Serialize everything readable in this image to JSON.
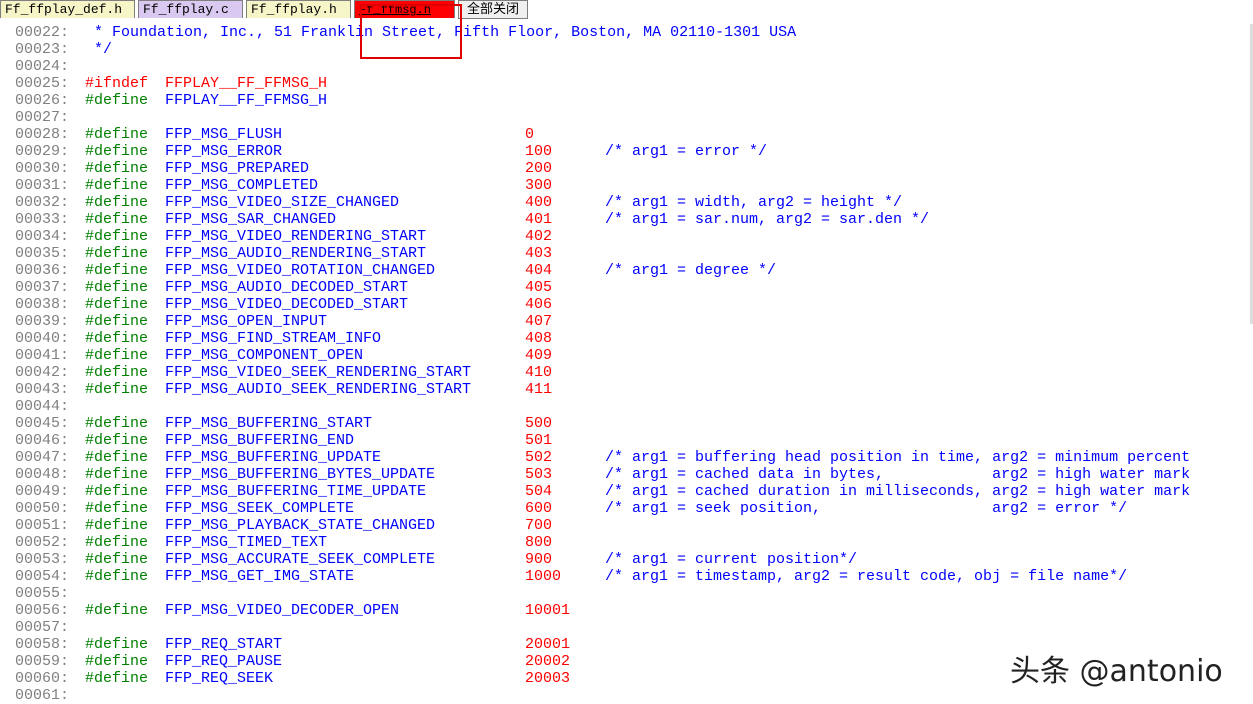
{
  "tabs": [
    {
      "label": "Ff_ffplay_def.h",
      "bg": "#f5f5c8"
    },
    {
      "label": "Ff_ffplay.c",
      "bg": "#d9c8ef"
    },
    {
      "label": "Ff_ffplay.h",
      "bg": "#f5f5c8"
    },
    {
      "label": "Ff_ffmsg.h",
      "bg": "#ff0000"
    }
  ],
  "close_all_label": "全部关闭",
  "header_lines": [
    {
      "num": "00022:",
      "text": " * Foundation, Inc., 51 Franklin Street, Fifth Floor, Boston, MA 02110-1301 USA"
    },
    {
      "num": "00023:",
      "text": " */"
    },
    {
      "num": "00024:",
      "text": ""
    }
  ],
  "guard_lines": [
    {
      "num": "00025:",
      "kw": "#ifndef",
      "ident": "FFPLAY__FF_FFMSG_H"
    },
    {
      "num": "00026:",
      "kw": "#define",
      "ident": "FFPLAY__FF_FFMSG_H"
    }
  ],
  "define_lines": [
    {
      "num": "00027:",
      "kw": "",
      "ident": "",
      "val": "",
      "cmt": ""
    },
    {
      "num": "00028:",
      "kw": "#define",
      "ident": "FFP_MSG_FLUSH",
      "val": "0",
      "cmt": ""
    },
    {
      "num": "00029:",
      "kw": "#define",
      "ident": "FFP_MSG_ERROR",
      "val": "100",
      "cmt": "/* arg1 = error */"
    },
    {
      "num": "00030:",
      "kw": "#define",
      "ident": "FFP_MSG_PREPARED",
      "val": "200",
      "cmt": ""
    },
    {
      "num": "00031:",
      "kw": "#define",
      "ident": "FFP_MSG_COMPLETED",
      "val": "300",
      "cmt": ""
    },
    {
      "num": "00032:",
      "kw": "#define",
      "ident": "FFP_MSG_VIDEO_SIZE_CHANGED",
      "val": "400",
      "cmt": "/* arg1 = width, arg2 = height */"
    },
    {
      "num": "00033:",
      "kw": "#define",
      "ident": "FFP_MSG_SAR_CHANGED",
      "val": "401",
      "cmt": "/* arg1 = sar.num, arg2 = sar.den */"
    },
    {
      "num": "00034:",
      "kw": "#define",
      "ident": "FFP_MSG_VIDEO_RENDERING_START",
      "val": "402",
      "cmt": ""
    },
    {
      "num": "00035:",
      "kw": "#define",
      "ident": "FFP_MSG_AUDIO_RENDERING_START",
      "val": "403",
      "cmt": ""
    },
    {
      "num": "00036:",
      "kw": "#define",
      "ident": "FFP_MSG_VIDEO_ROTATION_CHANGED",
      "val": "404",
      "cmt": "/* arg1 = degree */"
    },
    {
      "num": "00037:",
      "kw": "#define",
      "ident": "FFP_MSG_AUDIO_DECODED_START",
      "val": "405",
      "cmt": ""
    },
    {
      "num": "00038:",
      "kw": "#define",
      "ident": "FFP_MSG_VIDEO_DECODED_START",
      "val": "406",
      "cmt": ""
    },
    {
      "num": "00039:",
      "kw": "#define",
      "ident": "FFP_MSG_OPEN_INPUT",
      "val": "407",
      "cmt": ""
    },
    {
      "num": "00040:",
      "kw": "#define",
      "ident": "FFP_MSG_FIND_STREAM_INFO",
      "val": "408",
      "cmt": ""
    },
    {
      "num": "00041:",
      "kw": "#define",
      "ident": "FFP_MSG_COMPONENT_OPEN",
      "val": "409",
      "cmt": ""
    },
    {
      "num": "00042:",
      "kw": "#define",
      "ident": "FFP_MSG_VIDEO_SEEK_RENDERING_START",
      "val": "410",
      "cmt": ""
    },
    {
      "num": "00043:",
      "kw": "#define",
      "ident": "FFP_MSG_AUDIO_SEEK_RENDERING_START",
      "val": "411",
      "cmt": ""
    },
    {
      "num": "00044:",
      "kw": "",
      "ident": "",
      "val": "",
      "cmt": ""
    },
    {
      "num": "00045:",
      "kw": "#define",
      "ident": "FFP_MSG_BUFFERING_START",
      "val": "500",
      "cmt": ""
    },
    {
      "num": "00046:",
      "kw": "#define",
      "ident": "FFP_MSG_BUFFERING_END",
      "val": "501",
      "cmt": ""
    },
    {
      "num": "00047:",
      "kw": "#define",
      "ident": "FFP_MSG_BUFFERING_UPDATE",
      "val": "502",
      "cmt": "/* arg1 = buffering head position in time, arg2 = minimum percent"
    },
    {
      "num": "00048:",
      "kw": "#define",
      "ident": "FFP_MSG_BUFFERING_BYTES_UPDATE",
      "val": "503",
      "cmt": "/* arg1 = cached data in bytes,            arg2 = high water mark"
    },
    {
      "num": "00049:",
      "kw": "#define",
      "ident": "FFP_MSG_BUFFERING_TIME_UPDATE",
      "val": "504",
      "cmt": "/* arg1 = cached duration in milliseconds, arg2 = high water mark"
    },
    {
      "num": "00050:",
      "kw": "#define",
      "ident": "FFP_MSG_SEEK_COMPLETE",
      "val": "600",
      "cmt": "/* arg1 = seek position,                   arg2 = error */"
    },
    {
      "num": "00051:",
      "kw": "#define",
      "ident": "FFP_MSG_PLAYBACK_STATE_CHANGED",
      "val": "700",
      "cmt": ""
    },
    {
      "num": "00052:",
      "kw": "#define",
      "ident": "FFP_MSG_TIMED_TEXT",
      "val": "800",
      "cmt": ""
    },
    {
      "num": "00053:",
      "kw": "#define",
      "ident": "FFP_MSG_ACCURATE_SEEK_COMPLETE",
      "val": "900",
      "cmt": "/* arg1 = current position*/"
    },
    {
      "num": "00054:",
      "kw": "#define",
      "ident": "FFP_MSG_GET_IMG_STATE",
      "val": "1000",
      "cmt": "/* arg1 = timestamp, arg2 = result code, obj = file name*/"
    },
    {
      "num": "00055:",
      "kw": "",
      "ident": "",
      "val": "",
      "cmt": ""
    },
    {
      "num": "00056:",
      "kw": "#define",
      "ident": "FFP_MSG_VIDEO_DECODER_OPEN",
      "val": "10001",
      "cmt": ""
    },
    {
      "num": "00057:",
      "kw": "",
      "ident": "",
      "val": "",
      "cmt": ""
    },
    {
      "num": "00058:",
      "kw": "#define",
      "ident": "FFP_REQ_START",
      "val": "20001",
      "cmt": ""
    },
    {
      "num": "00059:",
      "kw": "#define",
      "ident": "FFP_REQ_PAUSE",
      "val": "20002",
      "cmt": ""
    },
    {
      "num": "00060:",
      "kw": "#define",
      "ident": "FFP_REQ_SEEK",
      "val": "20003",
      "cmt": ""
    },
    {
      "num": "00061:",
      "kw": "",
      "ident": "",
      "val": "",
      "cmt": ""
    }
  ],
  "watermark": "头条 @antonio"
}
